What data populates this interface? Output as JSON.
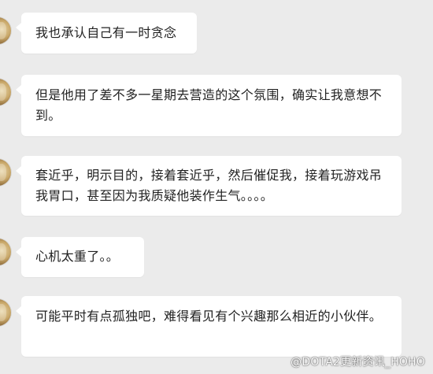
{
  "messages": [
    {
      "text": "我也承认自己有一时贪念"
    },
    {
      "text": "但是他用了差不多一星期去营造的这个氛围，确实让我意想不到。"
    },
    {
      "text": "套近乎，明示目的，接着套近乎，然后催促我，接着玩游戏吊我胃口，甚至因为我质疑他装作生气。。。。"
    },
    {
      "text": "心机太重了。。"
    },
    {
      "text": "可能平时有点孤独吧，难得看见有个兴趣那么相近的小伙伴。"
    }
  ],
  "watermark": "@DOTA2更新资讯_HOHO"
}
